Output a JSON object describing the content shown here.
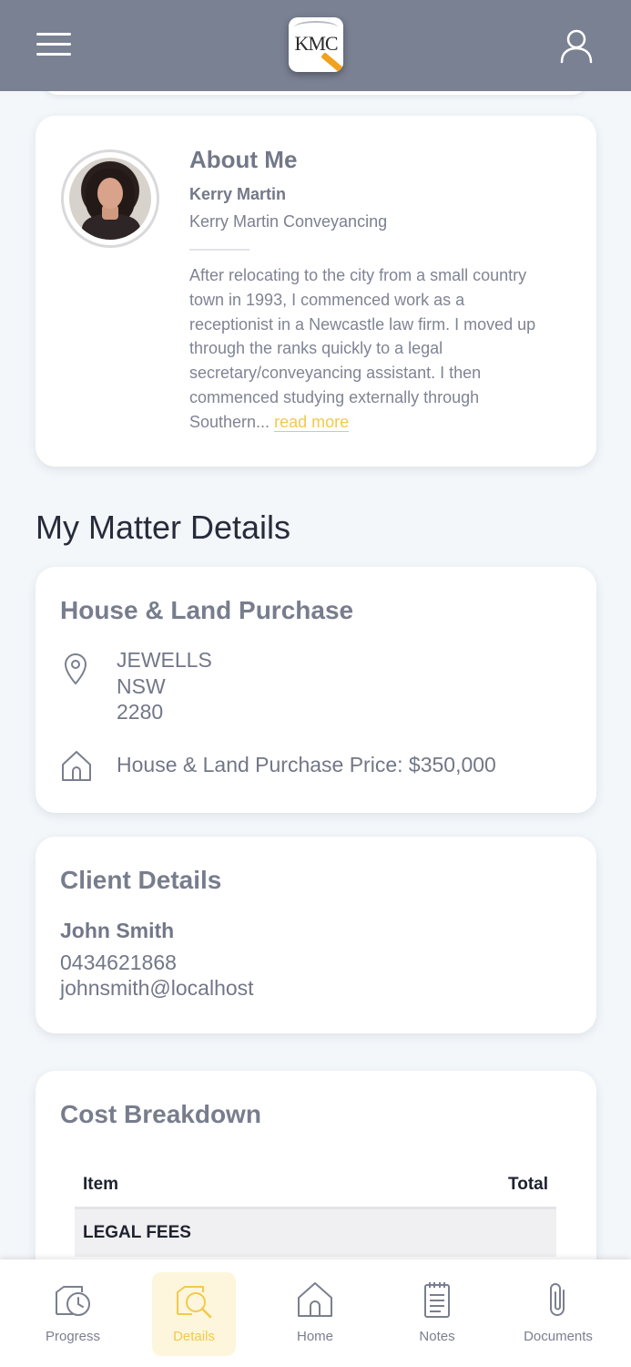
{
  "header": {
    "menu_icon": "hamburger-menu-icon",
    "logo_text": "KMC",
    "profile_icon": "user-profile-icon",
    "background": "#7a8193"
  },
  "about": {
    "title": "About Me",
    "name": "Kerry Martin",
    "company": "Kerry Martin Conveyancing",
    "bio_line1": "After relocating to the city from a small country",
    "bio_line2": "town in 1993, I commenced work as a",
    "bio_line3": "receptionist in a Newcastle law firm. I moved up",
    "bio_line4": "through the ranks quickly to a legal",
    "bio_line5": "secretary/conveyancing assistant. I then",
    "bio_line6": "commenced studying externally through",
    "bio_line7": "Southern...",
    "read_more": "read more"
  },
  "matter_section": {
    "heading": "My Matter Details"
  },
  "matter": {
    "title": "House & Land Purchase",
    "address_suburb": "JEWELLS",
    "address_state": "NSW",
    "address_postcode": "2280",
    "price": "House & Land Purchase Price: $350,000"
  },
  "client": {
    "title": "Client Details",
    "name": "John Smith",
    "phone": "0434621868",
    "email": "johnsmith@localhost"
  },
  "cost": {
    "title": "Cost Breakdown",
    "col_item": "Item",
    "col_total": "Total",
    "rows": [
      "LEGAL FEES"
    ]
  },
  "bottom_nav": {
    "items": [
      {
        "label": "Progress",
        "icon": "progress-clock-icon"
      },
      {
        "label": "Details",
        "icon": "details-search-icon",
        "active": true
      },
      {
        "label": "Home",
        "icon": "home-icon"
      },
      {
        "label": "Notes",
        "icon": "notes-icon"
      },
      {
        "label": "Documents",
        "icon": "paperclip-icon"
      }
    ],
    "active_color": "#f2c94c"
  }
}
